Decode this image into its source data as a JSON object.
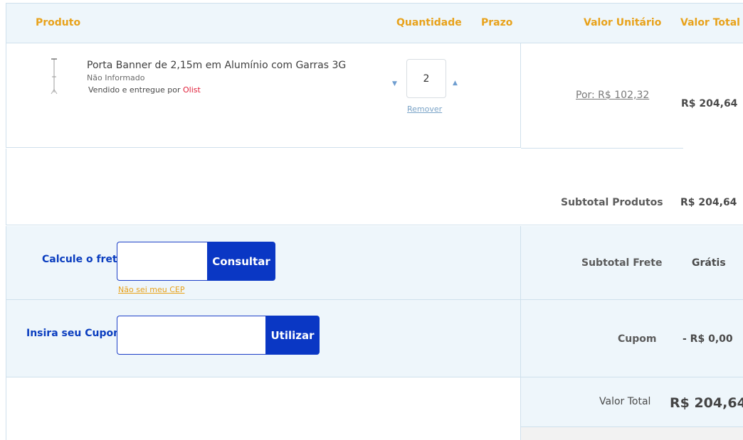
{
  "header": {
    "produto": "Produto",
    "quantidade": "Quantidade",
    "prazo": "Prazo",
    "valor_unitario": "Valor Unitário",
    "valor_total": "Valor Total"
  },
  "item": {
    "name": "Porta Banner de 2,15m em Alumínio com Garras 3G",
    "variant": "Não Informado",
    "sold_prefix": "Vendido e entregue por ",
    "seller": "Olist",
    "quantity": "2",
    "remove_label": "Remover",
    "unit_price": "Por: R$ 102,32",
    "total_price": "R$ 204,64"
  },
  "summary": {
    "subtotal_produtos_label": "Subtotal Produtos",
    "subtotal_produtos_value": "R$ 204,64",
    "subtotal_frete_label": "Subtotal Frete",
    "subtotal_frete_value": "Grátis",
    "cupom_label": "Cupom",
    "cupom_value": "- R$ 0,00",
    "valor_total_label": "Valor Total",
    "valor_total_value": "R$ 204,64"
  },
  "frete": {
    "label": "Calcule o frete",
    "input_value": "",
    "button": "Consultar",
    "help_link": "Não sei meu CEP"
  },
  "cupom": {
    "label": "Insira seu Cupom",
    "input_value": "",
    "button": "Utilizar"
  },
  "colors": {
    "accent_orange": "#e8a21b",
    "primary_blue": "#0a37c4",
    "header_bg": "#eef6fb",
    "seller_red": "#e0203a"
  }
}
